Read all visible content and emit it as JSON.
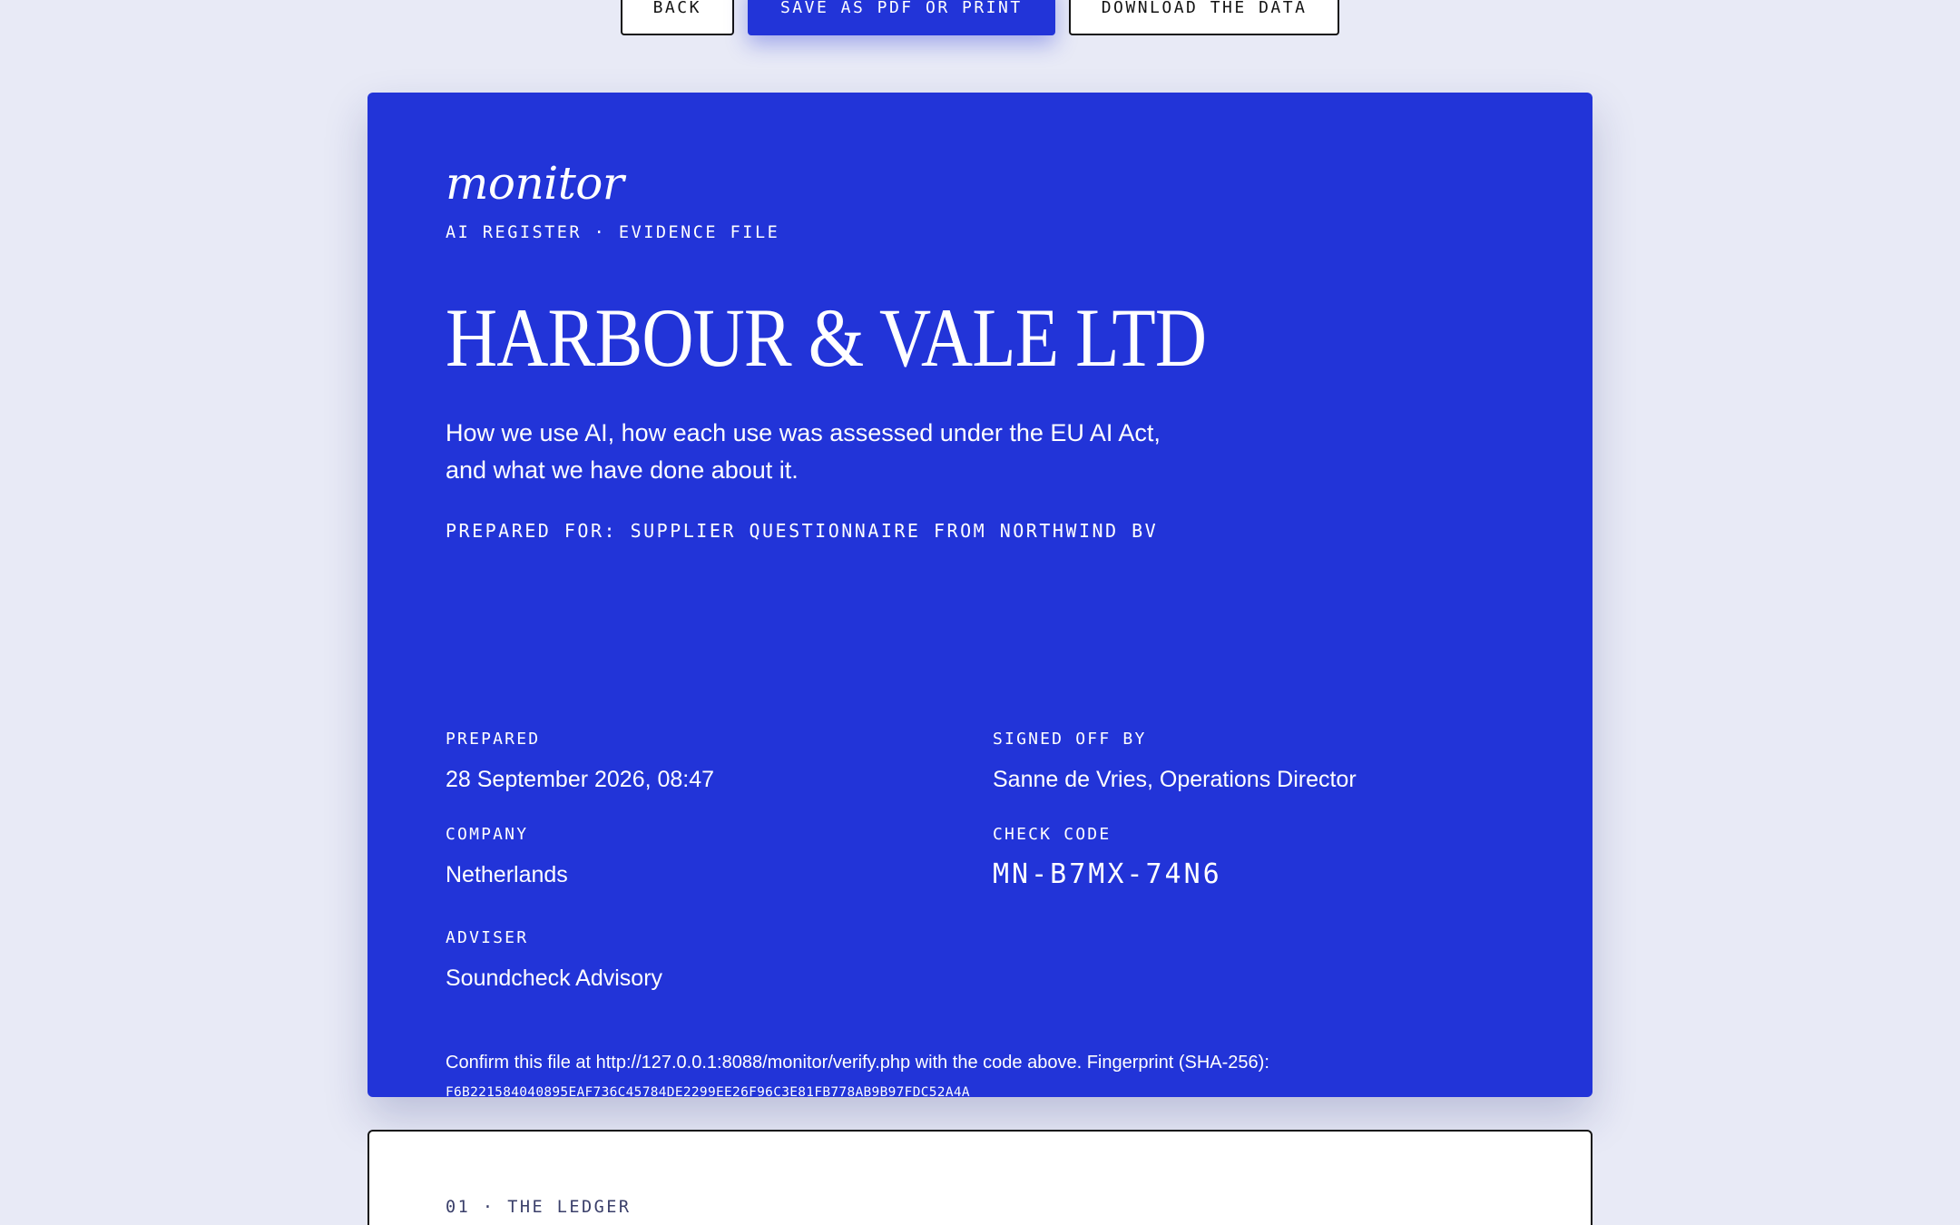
{
  "toolbar": {
    "back_label": "Back",
    "save_label": "Save as PDF or print",
    "download_label": "Download the data"
  },
  "cover": {
    "brand": "monitor",
    "kicker": "AI REGISTER · EVIDENCE FILE",
    "company_name": "HARBOUR & VALE LTD",
    "lede_line1": "How we use AI, how each use was assessed under the EU AI Act,",
    "lede_line2": "and what we have done about it.",
    "prepared_for": "PREPARED FOR: SUPPLIER QUESTIONNAIRE FROM NORTHWIND BV",
    "meta": {
      "prepared_label": "PREPARED",
      "prepared_value": "28 September 2026, 08:47",
      "signed_label": "SIGNED OFF BY",
      "signed_value": "Sanne de Vries, Operations Director",
      "company_label": "COMPANY",
      "company_value": "Netherlands",
      "check_label": "CHECK CODE",
      "check_value": "MN-B7MX-74N6",
      "adviser_label": "ADVISER",
      "adviser_value": "Soundcheck Advisory"
    },
    "verify_text": "Confirm this file at http://127.0.0.1:8088/monitor/verify.php with the code above. Fingerprint (SHA-256): ",
    "fingerprint": "F6B221584040895EAF736C45784DE2299EE26F96C3E81FB778AB9B97FDC52A4A"
  },
  "ledger": {
    "kicker": "01 · THE LEDGER"
  },
  "colors": {
    "accent": "#2234d8",
    "background": "#e8eaf6",
    "ink": "#141414"
  }
}
